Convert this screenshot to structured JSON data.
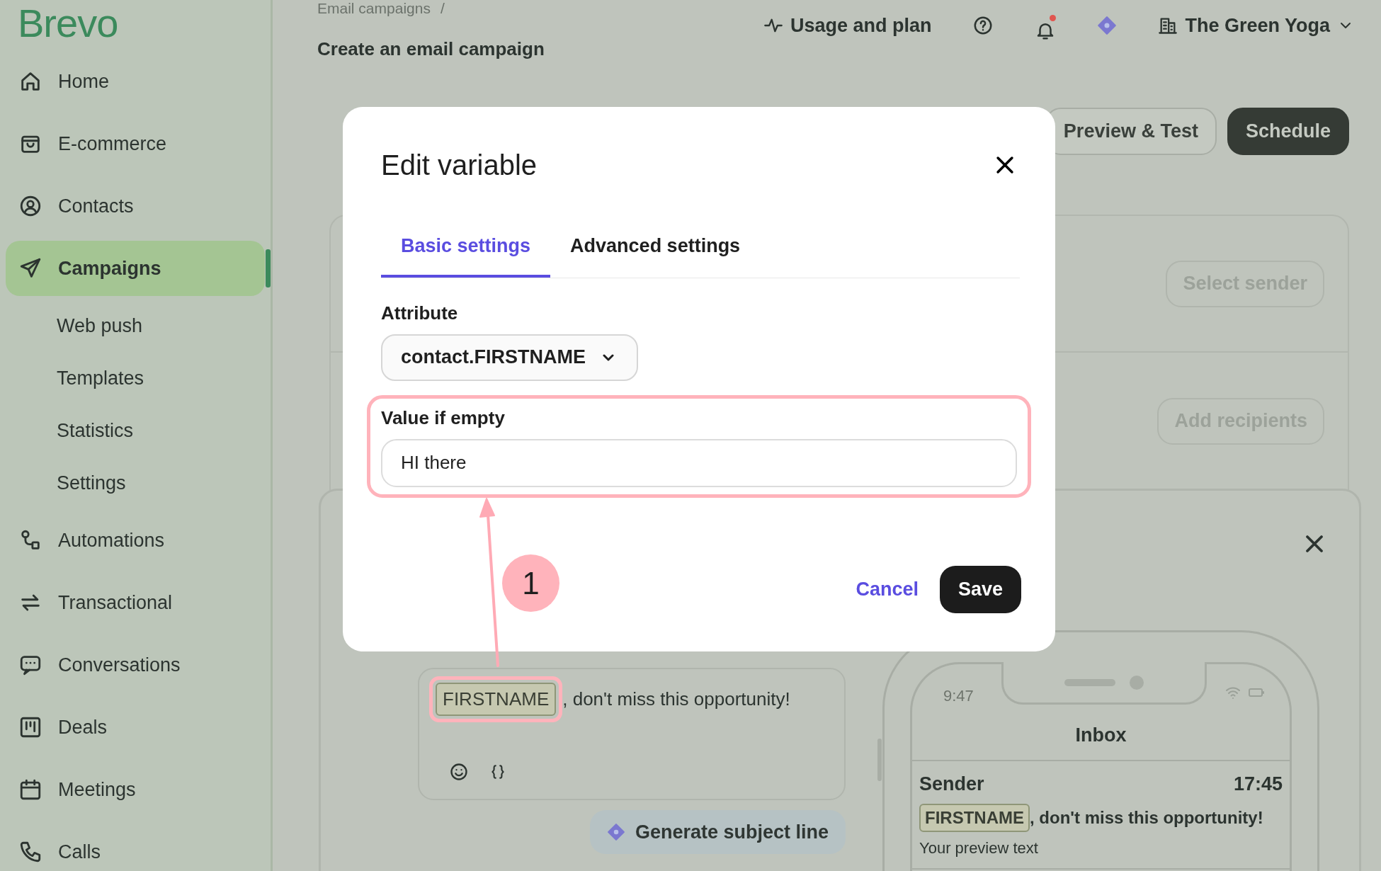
{
  "sidebar": {
    "logo": "Brevo",
    "items": [
      {
        "label": "Home",
        "kind": "main",
        "selected": false
      },
      {
        "label": "E-commerce",
        "kind": "main",
        "selected": false
      },
      {
        "label": "Contacts",
        "kind": "main",
        "selected": false
      },
      {
        "label": "Campaigns",
        "kind": "main",
        "selected": true
      },
      {
        "label": "Web push",
        "kind": "sub",
        "selected": false
      },
      {
        "label": "Templates",
        "kind": "sub",
        "selected": false
      },
      {
        "label": "Statistics",
        "kind": "sub",
        "selected": false
      },
      {
        "label": "Settings",
        "kind": "sub",
        "selected": false
      },
      {
        "label": "Automations",
        "kind": "main",
        "selected": false
      },
      {
        "label": "Transactional",
        "kind": "main",
        "selected": false
      },
      {
        "label": "Conversations",
        "kind": "main",
        "selected": false
      },
      {
        "label": "Deals",
        "kind": "main",
        "selected": false
      },
      {
        "label": "Meetings",
        "kind": "main",
        "selected": false
      },
      {
        "label": "Calls",
        "kind": "main",
        "selected": false
      }
    ]
  },
  "header": {
    "breadcrumb": [
      "Email campaigns",
      "/"
    ],
    "title": "Create an email campaign",
    "usage": "Usage and plan",
    "unread_notifications": true,
    "account": "The Green Yoga"
  },
  "actions": [
    "Preview & Test",
    "Schedule"
  ],
  "campaign": {
    "sender_button": "Select sender",
    "recipients_button": "Add recipients",
    "subject": {
      "variable": "FIRSTNAME",
      "text": ", don't miss this opportunity!"
    },
    "generate_button": "Generate subject line",
    "phone": {
      "time": "9:47",
      "title": "Inbox",
      "sender": "Sender",
      "received": "17:45",
      "variable": "FIRSTNAME",
      "subject": ", don't miss this opportunity!",
      "preview": "Your preview text"
    }
  },
  "modal": {
    "title": "Edit variable",
    "tabs": [
      {
        "label": "Basic settings",
        "selected": true
      },
      {
        "label": "Advanced settings",
        "selected": false
      }
    ],
    "attribute_label": "Attribute",
    "attribute_value": "contact.FIRSTNAME",
    "empty_label": "Value if empty",
    "empty_value": "HI there",
    "buttons": [
      "Cancel",
      "Save"
    ]
  },
  "annotation": {
    "step": "1"
  }
}
